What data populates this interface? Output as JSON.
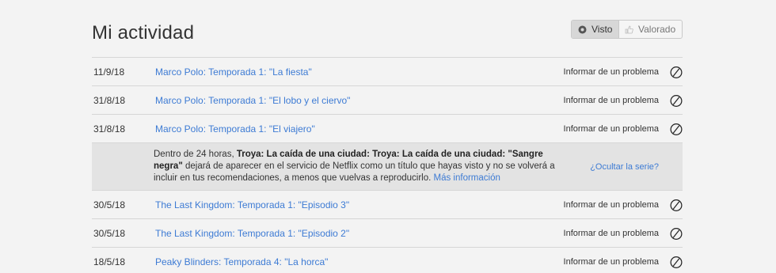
{
  "page": {
    "title": "Mi actividad"
  },
  "toggle": {
    "seen_label": "Visto",
    "rated_label": "Valorado",
    "active": "Visto"
  },
  "rows_before": [
    {
      "date": "11/9/18",
      "title": "Marco Polo: Temporada 1: \"La fiesta\"",
      "report": "Informar de un problema"
    },
    {
      "date": "31/8/18",
      "title": "Marco Polo: Temporada 1: \"El lobo y el ciervo\"",
      "report": "Informar de un problema"
    },
    {
      "date": "31/8/18",
      "title": "Marco Polo: Temporada 1: \"El viajero\"",
      "report": "Informar de un problema"
    }
  ],
  "notice": {
    "prefix": "Dentro de 24 horas, ",
    "bold": "Troya: La caída de una ciudad: Troya: La caída de una ciudad: \"Sangre negra\"",
    "suffix": " dejará de aparecer en el servicio de Netflix como un título que hayas visto y no se volverá a incluir en tus recomendaciones, a menos que vuelvas a reproducirlo. ",
    "more_link": "Más información",
    "hide_series": "¿Ocultar la serie?"
  },
  "rows_after": [
    {
      "date": "30/5/18",
      "title": "The Last Kingdom: Temporada 1: \"Episodio 3\"",
      "report": "Informar de un problema"
    },
    {
      "date": "30/5/18",
      "title": "The Last Kingdom: Temporada 1: \"Episodio 2\"",
      "report": "Informar de un problema"
    },
    {
      "date": "18/5/18",
      "title": "Peaky Blinders: Temporada 4: \"La horca\"",
      "report": "Informar de un problema"
    }
  ],
  "colors": {
    "link": "#3d7bd4",
    "background": "#f3f3f3",
    "notice_bg": "#e3e3e3"
  },
  "icons": {
    "hide": "prohibited-circle-icon",
    "seen": "eye-dot-icon",
    "rated": "thumb-icon"
  }
}
